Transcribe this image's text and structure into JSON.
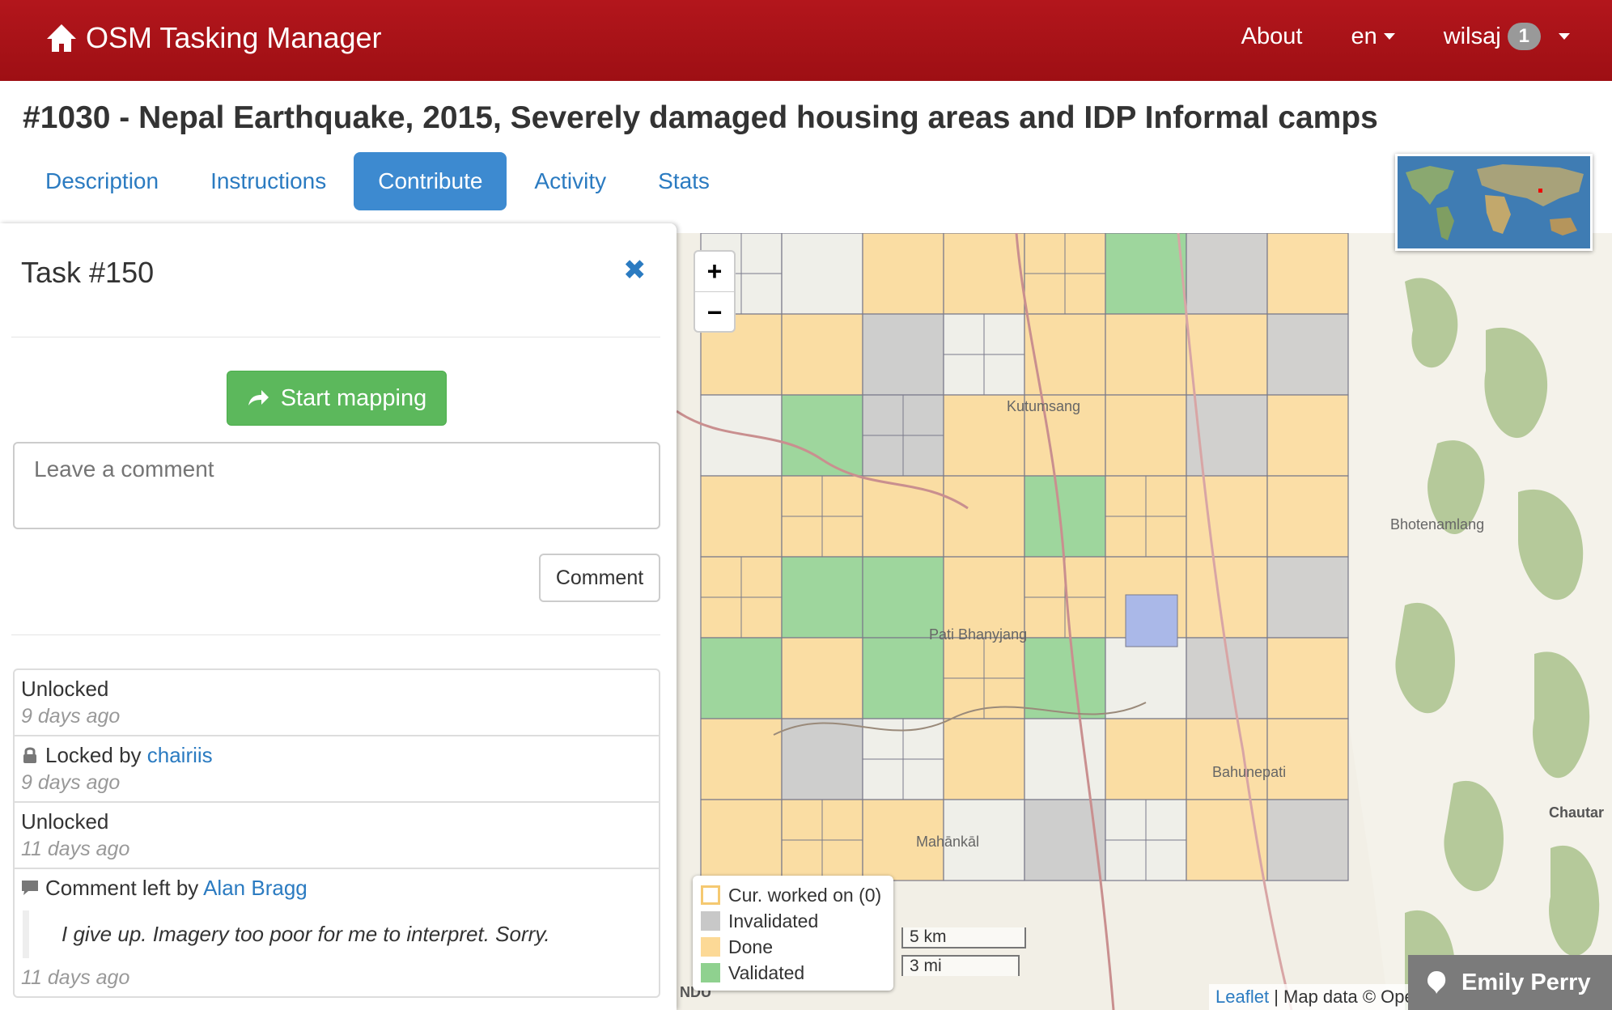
{
  "navbar": {
    "brand": "OSM Tasking Manager",
    "about": "About",
    "language": "en",
    "user": "wilsaj",
    "notification_count": "1"
  },
  "project": {
    "title": "#1030 - Nepal Earthquake, 2015, Severely damaged housing areas and IDP Informal camps"
  },
  "tabs": [
    {
      "label": "Description"
    },
    {
      "label": "Instructions"
    },
    {
      "label": "Contribute",
      "active": true
    },
    {
      "label": "Activity"
    },
    {
      "label": "Stats"
    }
  ],
  "task": {
    "title": "Task #150",
    "start_button": "Start mapping",
    "comment_placeholder": "Leave a comment",
    "comment_button": "Comment"
  },
  "history": [
    {
      "action": "Unlocked",
      "time": "9 days ago"
    },
    {
      "action": "Locked by",
      "user": "chairiis",
      "time": "9 days ago"
    },
    {
      "action": "Unlocked",
      "time": "11 days ago"
    },
    {
      "action": "Comment left by",
      "user": "Alan Bragg",
      "comment": "I give up. Imagery too poor for me to interpret. Sorry.",
      "time": "11 days ago"
    }
  ],
  "map": {
    "zoom_in": "+",
    "zoom_out": "−",
    "legend": [
      {
        "label": "Cur. worked on (0)",
        "color": "#ffffff",
        "border": "#f5c971"
      },
      {
        "label": "Invalidated",
        "color": "#c8c8c8"
      },
      {
        "label": "Done",
        "color": "#fcd996"
      },
      {
        "label": "Validated",
        "color": "#8fd18f"
      }
    ],
    "scale_km": "5 km",
    "scale_mi": "3 mi",
    "attribution_leaflet": "Leaflet",
    "attribution_rest": "| Map data © Ope",
    "places": [
      "Kutumsang",
      "Bhotenamlang",
      "Pati Bhanyjang",
      "Bahunepati",
      "Mahānkāl",
      "Chautar",
      "NDU"
    ]
  },
  "chat": {
    "name": "Emily Perry"
  },
  "colors": {
    "navbar": "#a8131a",
    "primary": "#3d8ad0",
    "success": "#5cb85c",
    "done": "#fcd996",
    "validated": "#8fd18f",
    "invalidated": "#c8c8c8"
  }
}
